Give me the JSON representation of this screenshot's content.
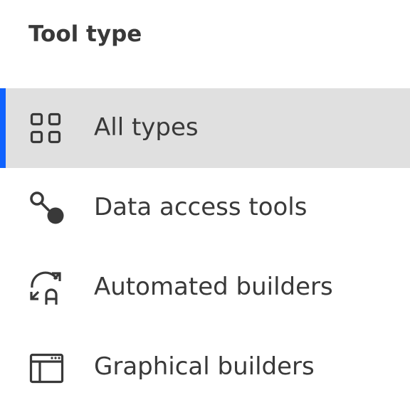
{
  "panel": {
    "title": "Tool type",
    "accent_color": "#0f62fe",
    "selected_bg": "#e0e0e0",
    "items": [
      {
        "label": "All types",
        "icon": "grid-icon",
        "selected": true
      },
      {
        "label": "Data access tools",
        "icon": "data-access-icon",
        "selected": false
      },
      {
        "label": "Automated builders",
        "icon": "automated-builder-icon",
        "selected": false
      },
      {
        "label": "Graphical builders",
        "icon": "graphical-builder-icon",
        "selected": false
      }
    ]
  }
}
